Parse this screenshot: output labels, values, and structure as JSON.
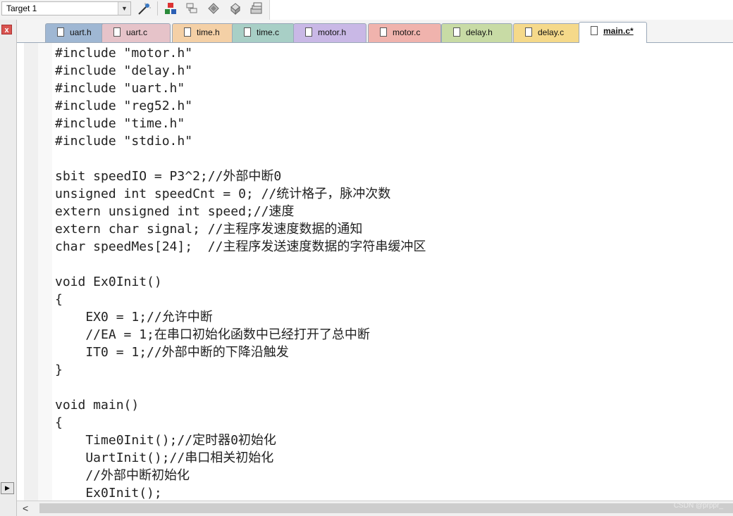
{
  "toolbar": {
    "target": "Target 1",
    "icons": [
      "dropdown-arrow-icon",
      "magic-wand-icon",
      "component-icon",
      "manage-books-icon",
      "options-icon",
      "pack-icon",
      "stack-icon"
    ]
  },
  "left_panel": {
    "close_glyph": "x",
    "scroll_glyph": "▶"
  },
  "tabs": [
    {
      "label": "uart.h",
      "color": "#9fb7d3",
      "active": false
    },
    {
      "label": "uart.c",
      "color": "#e6c3c9",
      "active": false
    },
    {
      "label": "time.h",
      "color": "#f4d0a6",
      "active": false
    },
    {
      "label": "time.c",
      "color": "#a8cfc6",
      "active": false
    },
    {
      "label": "motor.h",
      "color": "#c9b8e6",
      "active": false
    },
    {
      "label": "motor.c",
      "color": "#f0b3ad",
      "active": false
    },
    {
      "label": "delay.h",
      "color": "#c8dba5",
      "active": false
    },
    {
      "label": "delay.c",
      "color": "#f5d98a",
      "active": false
    },
    {
      "label": "main.c*",
      "color": "#ffffff",
      "active": true
    }
  ],
  "code_lines": [
    "#include \"motor.h\"",
    "#include \"delay.h\"",
    "#include \"uart.h\"",
    "#include \"reg52.h\"",
    "#include \"time.h\"",
    "#include \"stdio.h\"",
    "",
    "sbit speedIO = P3^2;//外部中断0",
    "unsigned int speedCnt = 0; //统计格子，脉冲次数",
    "extern unsigned int speed;//速度",
    "extern char signal; //主程序发速度数据的通知",
    "char speedMes[24];  //主程序发送速度数据的字符串缓冲区",
    "",
    "void Ex0Init()",
    "{",
    "    EX0 = 1;//允许中断",
    "    //EA = 1;在串口初始化函数中已经打开了总中断",
    "    IT0 = 1;//外部中断的下降沿触发",
    "}",
    "",
    "void main()",
    "{",
    "    Time0Init();//定时器0初始化",
    "    UartInit();//串口相关初始化",
    "    //外部中断初始化",
    "    Ex0Init();"
  ],
  "scrollbar": {
    "left_glyph": "<"
  },
  "watermark": "CSDN @prppr_"
}
